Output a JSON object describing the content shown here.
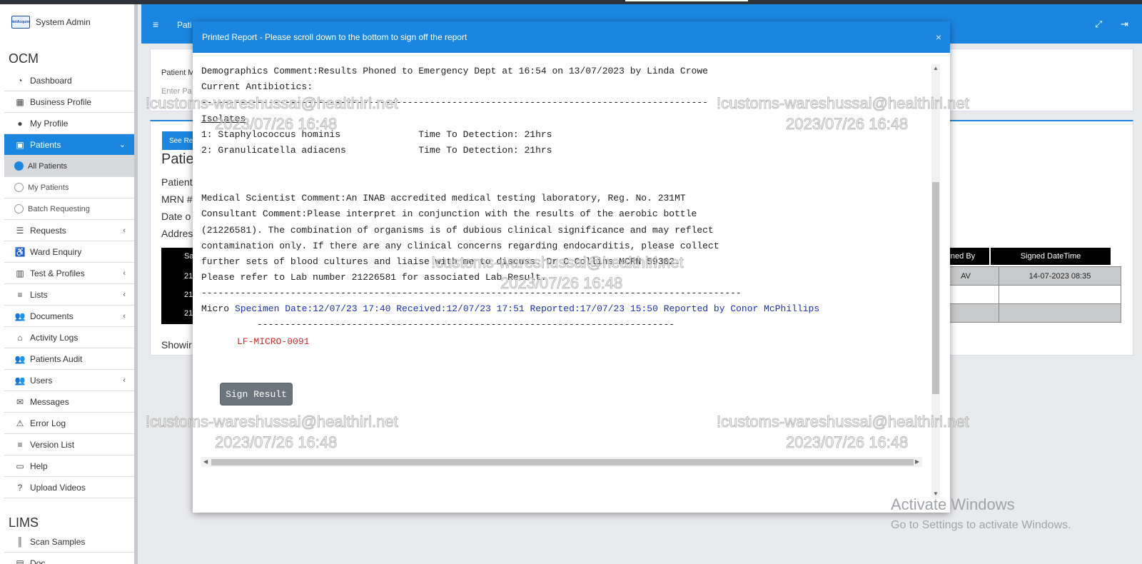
{
  "sidebar": {
    "app_title": "System Admin",
    "logo_text": "NetAcquire",
    "section_ocm": "OCM",
    "section_lims": "LIMS",
    "items": [
      {
        "label": "Dashboard"
      },
      {
        "label": "Business Profile"
      },
      {
        "label": "My Profile"
      },
      {
        "label": "Patients"
      },
      {
        "label": "All Patients"
      },
      {
        "label": "My Patients"
      },
      {
        "label": "Batch Requesting"
      },
      {
        "label": "Requests"
      },
      {
        "label": "Ward Enquiry"
      },
      {
        "label": "Test & Profiles"
      },
      {
        "label": "Lists"
      },
      {
        "label": "Documents"
      },
      {
        "label": "Activity Logs"
      },
      {
        "label": "Patients Audit"
      },
      {
        "label": "Users"
      },
      {
        "label": "Messages"
      },
      {
        "label": "Error Log"
      },
      {
        "label": "Version List"
      },
      {
        "label": "Help"
      },
      {
        "label": "Upload Videos"
      }
    ],
    "lims_items": [
      {
        "label": "Scan Samples"
      },
      {
        "label": "Doc…"
      }
    ]
  },
  "topbar": {
    "crumb": "Pati"
  },
  "background": {
    "patient_label": "Patient M",
    "search_placeholder": "Enter Pa",
    "see_req": "See Req",
    "heading": "Patie",
    "patient_line": "Patient",
    "mrn": "MRN #",
    "date": "Date o",
    "address": "Addres",
    "showing": "Showir",
    "black_rows": [
      "Sa",
      "21",
      "21",
      "21"
    ],
    "signed_by": "gned By",
    "signed_datetime": "Signed DateTime",
    "row1_by": "AV",
    "row1_dt": "14-07-2023 08:35"
  },
  "modal": {
    "title": "Printed Report - Please scroll down to the bottom to sign off the report",
    "close": "×",
    "lines": {
      "demo": "Demographics Comment:Results Phoned to Emergency Dept at 16:54 on 13/07/2023 by Linda Crowe",
      "antibiotics": "Current Antibiotics:",
      "dashes1": "-------------------------------------------------------------------------------------------",
      "isolates": "Isolates",
      "iso1": "1: Staphylococcus hominis              Time To Detection: 21hrs",
      "iso2": "2: Granulicatella adiacens             Time To Detection: 21hrs",
      "msc": "Medical Scientist Comment:An INAB accredited medical testing laboratory, Reg. No. 231MT",
      "cc1": "Consultant Comment:Please interpret in conjunction with the results of the aerobic bottle",
      "cc2": "(21226581). The combination of organisms is of dubious clinical significance and may reflect",
      "cc3": "contamination only. If there are any clinical concerns regarding endocarditis, please collect",
      "cc4": "further sets of blood cultures and liaise with me to discuss. Dr C Collins MCRN 59302.",
      "refer": "Please refer to Lab number 21226581 for associated Lab Result.",
      "dashes2": "-------------------------------------------------------------------------------------------------",
      "micro": "Micro",
      "micro_details": "Specimen Date:12/07/23 17:40 Received:12/07/23 17:51 Reported:17/07/23 15:50 Reported by Conor McPhillips",
      "dashes3": "---------------------------------------------------------------------------",
      "code": "LF-MICRO-0091"
    },
    "sign_button": "Sign Result"
  },
  "watermark": {
    "email": "!customs-wareshussai@healthirl.net",
    "time": "2023/07/26 16:48"
  },
  "activate": {
    "line1": "Activate Windows",
    "line2": "Go to Settings to activate Windows."
  }
}
